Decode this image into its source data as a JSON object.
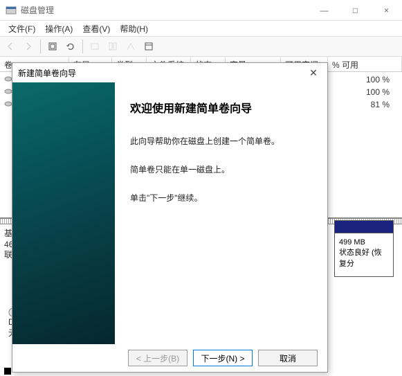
{
  "window": {
    "title": "磁盘管理",
    "min": "—",
    "max": "□",
    "close": "×"
  },
  "menu": {
    "file": "文件(F)",
    "action": "操作(A)",
    "view": "查看(V)",
    "help": "帮助(H)"
  },
  "columns": {
    "vol": "卷",
    "layout": "布局",
    "type": "类型",
    "fs": "文件系统",
    "status": "状态",
    "capacity": "容量",
    "free": "可用空间",
    "pct": "% 可用"
  },
  "pct_values": [
    "100 %",
    "100 %",
    "81 %"
  ],
  "disk": {
    "label_prefix": "基",
    "label_size": "46",
    "label_online": "联"
  },
  "partition_right": {
    "size": "499 MB",
    "status": "状态良好 (恢复分"
  },
  "cd": {
    "prefix": "D\\",
    "nomedia": "无"
  },
  "wizard": {
    "title": "新建简单卷向导",
    "heading": "欢迎使用新建简单卷向导",
    "p1": "此向导帮助你在磁盘上创建一个简单卷。",
    "p2": "简单卷只能在单一磁盘上。",
    "p3": "单击\"下一步\"继续。",
    "back": "< 上一步(B)",
    "next": "下一步(N) >",
    "cancel": "取消"
  }
}
